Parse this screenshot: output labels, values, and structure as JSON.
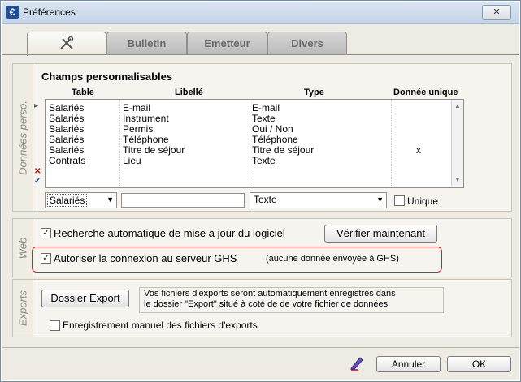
{
  "window": {
    "title": "Préférences",
    "icon": "app-icon",
    "close_label": "✕"
  },
  "tabs": [
    {
      "label": "",
      "icon": "tools-icon"
    },
    {
      "label": "Bulletin"
    },
    {
      "label": "Emetteur"
    },
    {
      "label": "Divers"
    }
  ],
  "donnees": {
    "side_label": "Données perso.",
    "title": "Champs personnalisables",
    "columns": [
      "Table",
      "Libellé",
      "Type",
      "Donnée unique"
    ],
    "rows": [
      {
        "table": "Salariés",
        "libelle": "E-mail",
        "type": "E-mail",
        "unique": ""
      },
      {
        "table": "Salariés",
        "libelle": "Instrument",
        "type": "Texte",
        "unique": ""
      },
      {
        "table": "Salariés",
        "libelle": "Permis",
        "type": "Oui / Non",
        "unique": ""
      },
      {
        "table": "Salariés",
        "libelle": "Téléphone",
        "type": "Téléphone",
        "unique": ""
      },
      {
        "table": "Salariés",
        "libelle": "Titre de séjour",
        "type": "Titre de séjour",
        "unique": "x"
      },
      {
        "table": "Contrats",
        "libelle": "Lieu",
        "type": "Texte",
        "unique": ""
      }
    ],
    "table_select": "Salariés",
    "libelle_value": "",
    "type_select": "Texte",
    "unique_label": "Unique",
    "unique_checked": false
  },
  "web": {
    "side_label": "Web",
    "auto_update_label": "Recherche automatique de mise à jour du logiciel",
    "auto_update_checked": true,
    "check_now_label": "Vérifier maintenant",
    "ghs_label": "Autoriser la connexion au serveur GHS",
    "ghs_checked": true,
    "ghs_note": "(aucune donnée envoyée à GHS)"
  },
  "exports": {
    "side_label": "Exports",
    "dossier_button": "Dossier Export",
    "info_line1": "Vos fichiers d'exports seront automatiquement enregistrés dans",
    "info_line2": "le dossier \"Export\" situé à coté de de votre fichier de données.",
    "manual_label": "Enregistrement manuel des fichiers d'exports",
    "manual_checked": false
  },
  "footer": {
    "cancel_label": "Annuler",
    "ok_label": "OK"
  },
  "colors": {
    "highlight": "#d81f1f",
    "delete": "#c00000",
    "confirm": "#1f3fa0"
  }
}
